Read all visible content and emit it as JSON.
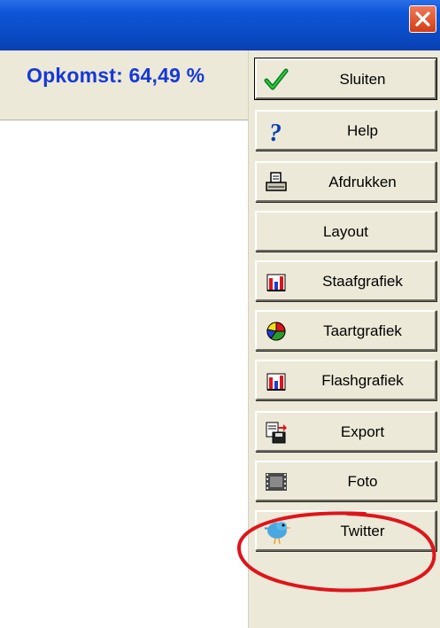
{
  "window": {
    "close_icon": "close-icon"
  },
  "result": {
    "turnout_text": "Opkomst: 64,49 %"
  },
  "buttons": [
    {
      "name": "close-button",
      "label": "Sluiten",
      "icon": "checkmark-icon"
    },
    {
      "name": "help-button",
      "label": "Help",
      "icon": "question-icon"
    },
    {
      "name": "print-button",
      "label": "Afdrukken",
      "icon": "printer-icon"
    },
    {
      "name": "layout-button",
      "label": "Layout",
      "icon": ""
    },
    {
      "name": "bar-chart-button",
      "label": "Staafgrafiek",
      "icon": "bar-chart-icon"
    },
    {
      "name": "pie-chart-button",
      "label": "Taartgrafiek",
      "icon": "pie-chart-icon"
    },
    {
      "name": "flash-chart-button",
      "label": "Flashgrafiek",
      "icon": "bar-chart-icon"
    },
    {
      "name": "export-button",
      "label": "Export",
      "icon": "export-disk-icon"
    },
    {
      "name": "photo-button",
      "label": "Foto",
      "icon": "film-strip-icon"
    },
    {
      "name": "twitter-button",
      "label": "Twitter",
      "icon": "twitter-bird-icon"
    }
  ],
  "colors": {
    "titlebar": "#0a4ac4",
    "turnout_text": "#1638d9",
    "annotation_circle": "#e0141a",
    "button_face": "#ece9d8"
  }
}
